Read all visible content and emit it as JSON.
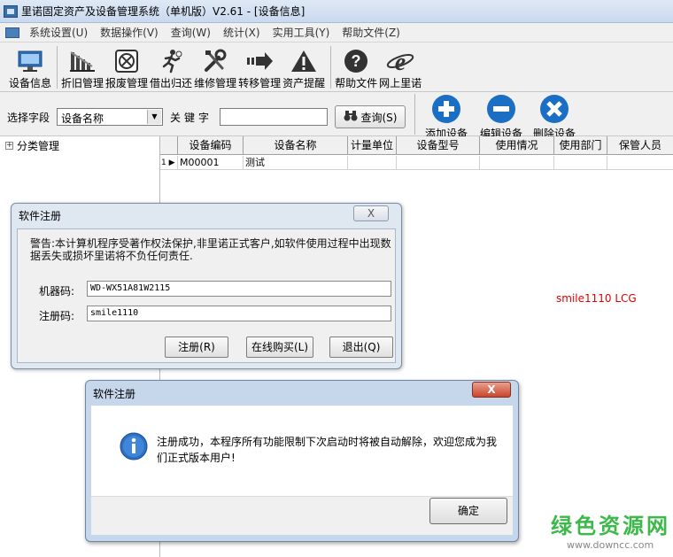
{
  "window": {
    "title": "里诺固定资产及设备管理系统（单机版）V2.61 - [设备信息]"
  },
  "menu": [
    "系统设置(U)",
    "数据操作(V)",
    "查询(W)",
    "统计(X)",
    "实用工具(Y)",
    "帮助文件(Z)"
  ],
  "toolbar": [
    {
      "label": "设备信息",
      "icon": "monitor-icon"
    },
    {
      "label": "折旧管理",
      "icon": "chart-icon"
    },
    {
      "label": "报废管理",
      "icon": "scrap-icon"
    },
    {
      "label": "借出归还",
      "icon": "runner-icon"
    },
    {
      "label": "维修管理",
      "icon": "tools-icon"
    },
    {
      "label": "转移管理",
      "icon": "arrow-icon"
    },
    {
      "label": "资产提醒",
      "icon": "warning-icon"
    },
    {
      "label": "帮助文件",
      "icon": "help-icon"
    },
    {
      "label": "网上里诺",
      "icon": "ie-icon"
    }
  ],
  "search": {
    "field_label": "选择字段",
    "field_value": "设备名称",
    "keyword_label": "关键字",
    "keyword_value": "",
    "query_label": "查询(S)",
    "add_label": "添加设备",
    "edit_label": "编辑设备",
    "delete_label": "删除设备"
  },
  "tree": {
    "root_label": "分类管理"
  },
  "grid": {
    "columns": [
      "设备编码",
      "设备名称",
      "计量单位",
      "设备型号",
      "使用情况",
      "使用部门",
      "保管人员"
    ],
    "rows": [
      {
        "num": "1",
        "cells": [
          "M00001",
          "测试",
          "",
          "",
          "",
          "",
          ""
        ]
      }
    ]
  },
  "side_text": "smile1110 LCG",
  "register_dialog": {
    "title": "软件注册",
    "close_label": "X",
    "warning": "警告:本计算机程序受著作权法保护,非里诺正式客户,如软件使用过程中出现数据丢失或损坏里诺将不负任何责任.",
    "machine_label": "机器码:",
    "machine_value": "WD-WX51A81W2115",
    "reg_label": "注册码:",
    "reg_value": "smile1110",
    "register_button": "注册(R)",
    "buy_button": "在线购买(L)",
    "exit_button": "退出(Q)"
  },
  "success_dialog": {
    "title": "软件注册",
    "close_label": "X",
    "message": "注册成功，本程序所有功能限制下次启动时将被自动解除，欢迎您成为我们正式版本用户!",
    "ok_label": "确定"
  },
  "watermark": {
    "text": "绿色资源网",
    "url": "www.downcc.com"
  },
  "colors": {
    "accent_blue": "#1a6fc4",
    "red": "#e00000",
    "watermark_green": "#3db84a"
  }
}
